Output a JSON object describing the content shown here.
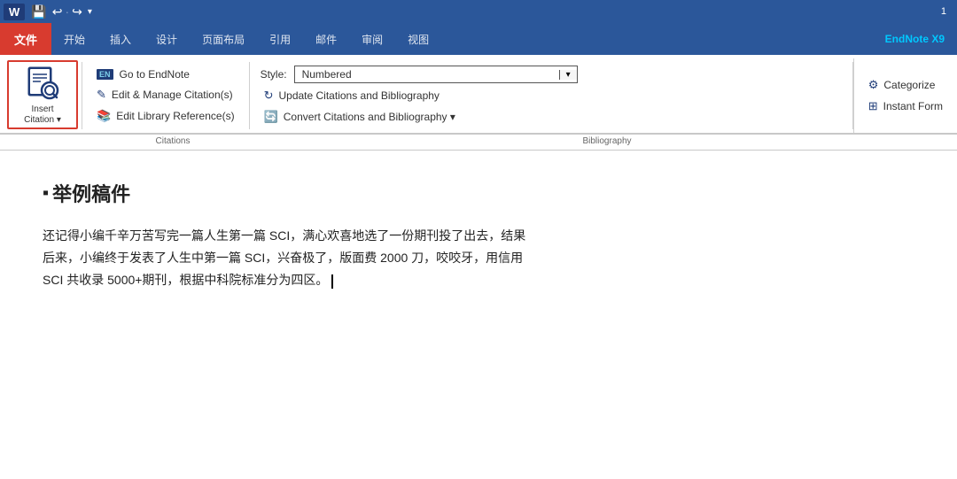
{
  "titlebar": {
    "page_number": "1"
  },
  "ribbon": {
    "quickaccess": {
      "word_label": "W",
      "save_icon": "💾",
      "undo_icon": "↩",
      "redo_icon": "↪",
      "more_icon": "▾"
    },
    "tabs": [
      {
        "id": "file",
        "label": "文件"
      },
      {
        "id": "home",
        "label": "开始"
      },
      {
        "id": "insert",
        "label": "插入"
      },
      {
        "id": "design",
        "label": "设计"
      },
      {
        "id": "layout",
        "label": "页面布局"
      },
      {
        "id": "references",
        "label": "引用"
      },
      {
        "id": "mailings",
        "label": "邮件"
      },
      {
        "id": "review",
        "label": "审阅"
      },
      {
        "id": "view",
        "label": "视图"
      },
      {
        "id": "endnote",
        "label": "EndNote X9"
      }
    ],
    "insert_citation": {
      "label_line1": "Insert",
      "label_line2": "Citation",
      "label_suffix": "▾"
    },
    "citations_group": {
      "label": "Citations",
      "actions": [
        {
          "id": "go-to-endnote",
          "prefix": "EN",
          "text": "Go to EndNote"
        },
        {
          "id": "edit-manage",
          "icon": "✎",
          "text": "Edit & Manage Citation(s)"
        },
        {
          "id": "edit-library",
          "icon": "📚",
          "text": "Edit Library Reference(s)"
        }
      ]
    },
    "bibliography_group": {
      "label": "Bibliography",
      "style_label": "Style:",
      "style_value": "Numbered",
      "actions": [
        {
          "id": "update-citations",
          "icon": "↻",
          "text": "Update Citations and Bibliography"
        },
        {
          "id": "convert-citations",
          "icon": "🔄",
          "text": "Convert Citations and Bibliography ▾"
        }
      ]
    },
    "right_group": {
      "actions": [
        {
          "id": "categorize",
          "icon": "⚙",
          "text": "Categorize"
        },
        {
          "id": "instant-form",
          "icon": "⊞",
          "text": "Instant Form"
        }
      ]
    }
  },
  "document": {
    "title": "举例稿件",
    "paragraphs": [
      "还记得小编千辛万苦写完一篇人生第一篇 SCI，满心欢喜地选了一份期刊投了出去，结果",
      "后来，小编终于发表了人生中第一篇 SCI，兴奋极了，版面费 2000 刀，咬咬牙，用信用",
      "SCI 共收录 5000+期刊，根据中科院标准分为四区。"
    ]
  }
}
